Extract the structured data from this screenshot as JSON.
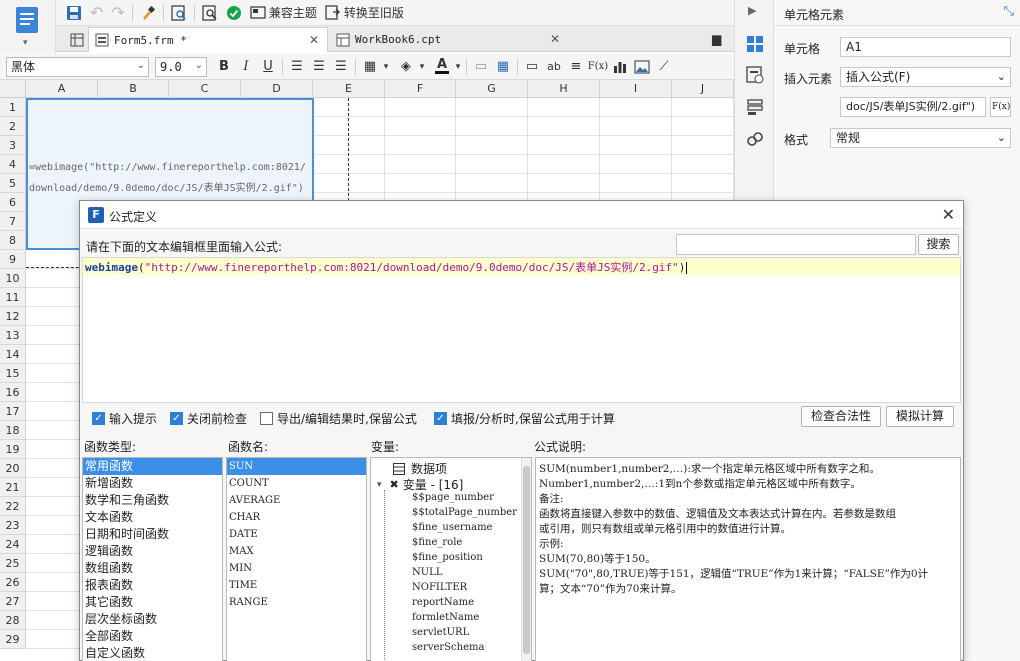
{
  "toolbar": {
    "compat_theme": "兼容主题",
    "convert_old": "转换至旧版"
  },
  "tabs": [
    {
      "label": "Form5.frm *"
    },
    {
      "label": "WorkBook6.cpt"
    }
  ],
  "format": {
    "font": "黑体",
    "size": "9.0",
    "bold": "B",
    "italic": "I",
    "underline": "U",
    "fx": "F(x)",
    "ab": "ab"
  },
  "grid": {
    "columns": [
      "A",
      "B",
      "C",
      "D",
      "E",
      "F",
      "G",
      "H",
      "I",
      "J"
    ],
    "rows": [
      "1",
      "2",
      "3",
      "4",
      "5",
      "6",
      "7",
      "8",
      "9",
      "10",
      "11",
      "12",
      "13",
      "14",
      "15",
      "16",
      "17",
      "18",
      "19",
      "20",
      "21",
      "22",
      "23",
      "24",
      "25",
      "26",
      "27",
      "28",
      "29"
    ],
    "cell_text_line1": "=webimage(\"http://www.finereporthelp.com:8021/",
    "cell_text_line2": "download/demo/9.0demo/doc/JS/表单JS实例/2.gif\")"
  },
  "props": {
    "header": "单元格元素",
    "cell_label": "单元格",
    "cell_value": "A1",
    "insert_label": "插入元素",
    "insert_value": "插入公式(F)",
    "formula_preview": "doc/JS/表单JS实例/2.gif\")",
    "fx_button": "F(x)",
    "format_label": "格式",
    "format_value": "常规"
  },
  "dialog": {
    "title": "公式定义",
    "prompt": "请在下面的文本编辑框里面输入公式:",
    "search_button": "搜索",
    "formula_func": "webimage",
    "formula_paren_open": "(",
    "formula_string": "\"http://www.finereporthelp.com:8021/download/demo/9.0demo/doc/JS/表单JS实例/2.gif\"",
    "formula_paren_close": ")",
    "options": [
      {
        "label": "输入提示",
        "checked": true
      },
      {
        "label": "关闭前检查",
        "checked": true
      },
      {
        "label": "导出/编辑结果时,保留公式",
        "checked": false
      },
      {
        "label": "填报/分析时,保留公式用于计算",
        "checked": true
      }
    ],
    "check_button": "检查合法性",
    "simulate_button": "模拟计算",
    "func_type_header": "函数类型:",
    "func_name_header": "函数名:",
    "var_header": "变量:",
    "desc_header": "公式说明:",
    "func_types": [
      "常用函数",
      "新增函数",
      "数学和三角函数",
      "文本函数",
      "日期和时间函数",
      "逻辑函数",
      "数组函数",
      "报表函数",
      "其它函数",
      "层次坐标函数",
      "全部函数",
      "自定义函数"
    ],
    "func_names": [
      "SUN",
      "COUNT",
      "AVERAGE",
      "CHAR",
      "DATE",
      "MAX",
      "MIN",
      "TIME",
      "RANGE"
    ],
    "var_root": "数据项",
    "var_group": "变量 - [16]",
    "variables": [
      "$$page_number",
      "$$totalPage_number",
      "$fine_username",
      "$fine_role",
      "$fine_position",
      "NULL",
      "NOFILTER",
      "reportName",
      "formletName",
      "servletURL",
      "serverSchema"
    ],
    "desc_lines": [
      "SUM(number1,number2,…):求一个指定单元格区域中所有数字之和。",
      "Number1,number2,…:1到n个参数或指定单元格区域中所有数字。",
      "备注:",
      "函数将直接键入参数中的数值、逻辑值及文本表达式计算在内。若参数是数组",
      "或引用，则只有数组或单元格引用中的数值进行计算。",
      "示例:",
      "SUM(70,80)等于150。",
      "SUM(\"70\",80,TRUE)等于151，逻辑值“TRUE”作为1来计算；“FALSE”作为0计",
      "算；文本“70”作为70来计算。"
    ]
  },
  "colors": {
    "accent": "#3c8fe6",
    "selection_border": "#4a90d9",
    "formula_bg": "#ffffcc",
    "formula_func": "#1a3ea8",
    "formula_string": "#b3139c"
  }
}
